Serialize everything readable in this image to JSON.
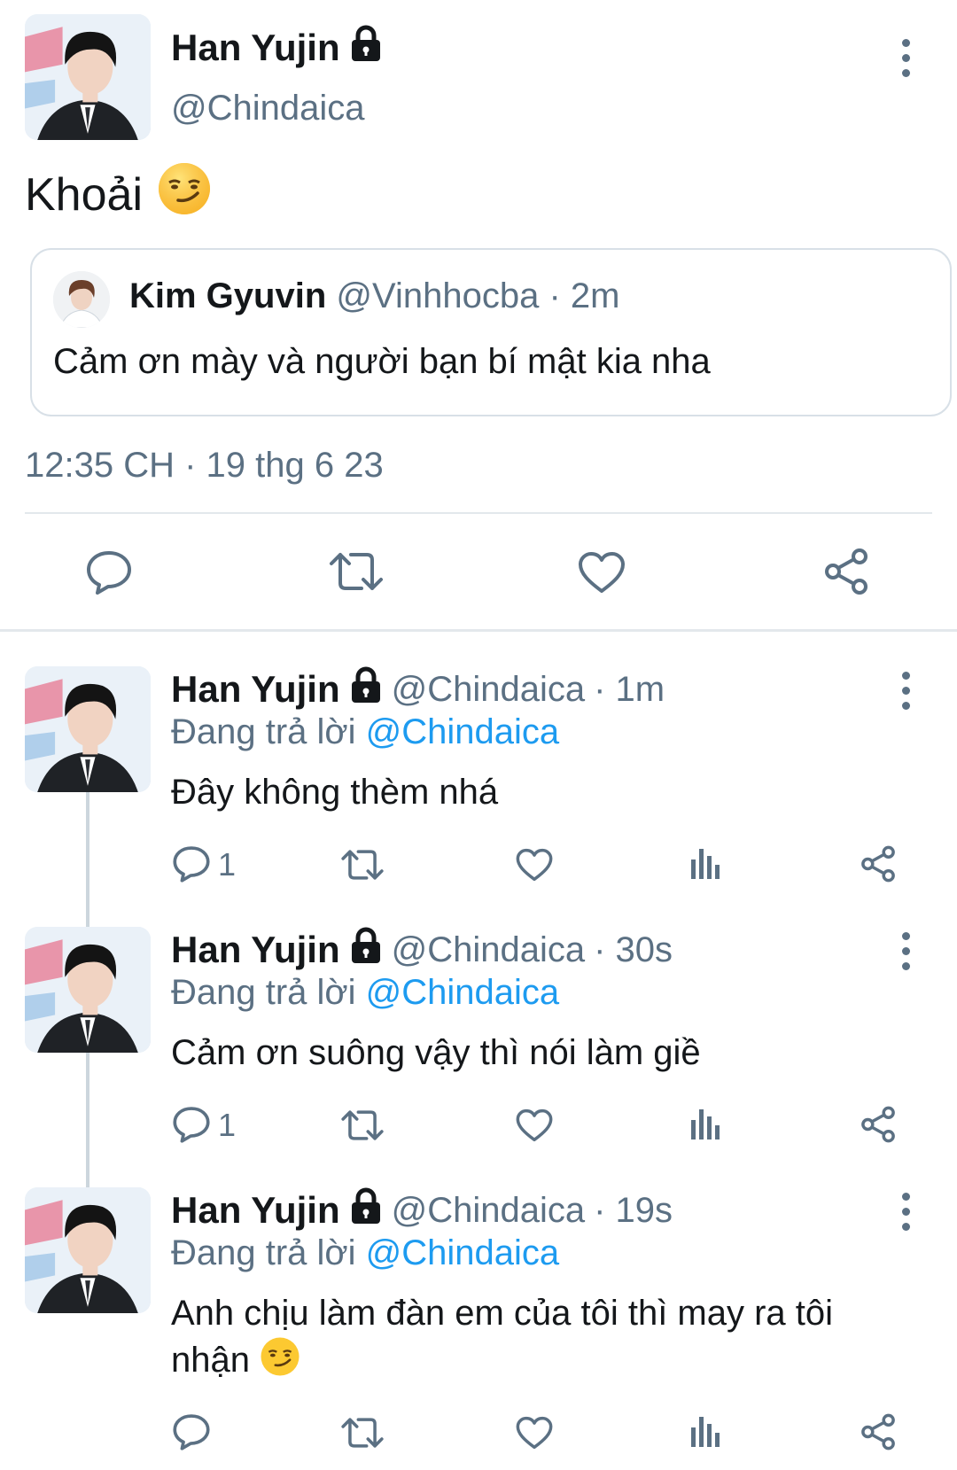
{
  "main_tweet": {
    "name": "Han Yujin",
    "handle": "@Chindaica",
    "text": "Khoải",
    "emoji": "smirk-emoji",
    "quoted": {
      "name": "Kim Gyuvin",
      "handle": "@Vinhhocba",
      "time": "· 2m",
      "text": "Cảm ơn mày và người bạn bí mật kia nha"
    },
    "timestamp": "12:35 CH · 19 thg 6 23",
    "actions": [
      "reply-icon",
      "retweet-icon",
      "like-icon",
      "share-icon"
    ]
  },
  "replies": [
    {
      "name": "Han Yujin",
      "handle": "@Chindaica",
      "time": "· 1m",
      "replying_prefix": "Đang trả lời",
      "replying_to": "@Chindaica",
      "text": "Đây không thèm nhá",
      "reply_count": "1"
    },
    {
      "name": "Han Yujin",
      "handle": "@Chindaica",
      "time": "· 30s",
      "replying_prefix": "Đang trả lời",
      "replying_to": "@Chindaica",
      "text": "Cảm ơn suông vậy thì nói làm giề",
      "reply_count": "1"
    },
    {
      "name": "Han Yujin",
      "handle": "@Chindaica",
      "time": "· 19s",
      "replying_prefix": "Đang trả lời",
      "replying_to": "@Chindaica",
      "text": "Anh chịu làm đàn em của tôi thì may ra tôi nhận",
      "emoji": "smirk-emoji",
      "reply_count": ""
    }
  ],
  "colors": {
    "link": "#1d9bf0",
    "muted": "#5b7083",
    "divider": "#e3e8ec"
  }
}
